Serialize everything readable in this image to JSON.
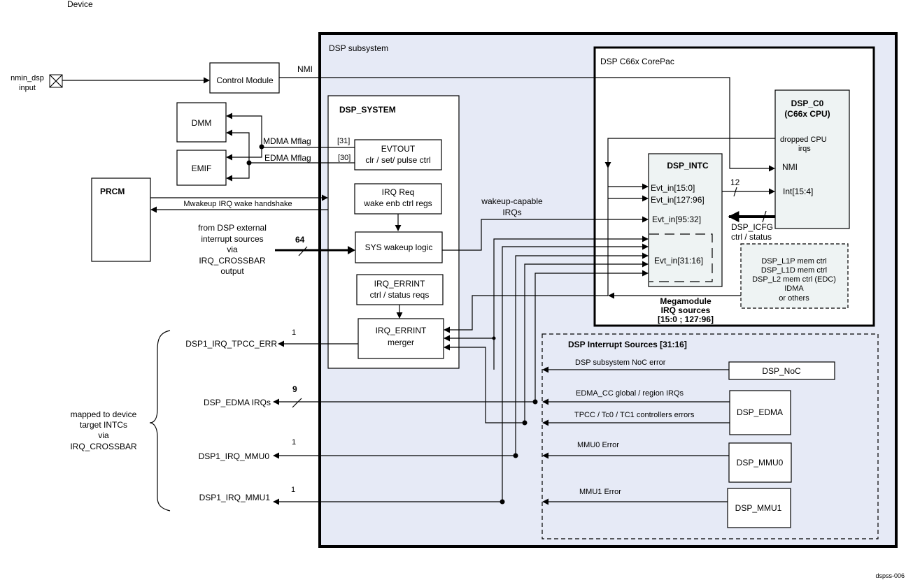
{
  "figure_id": "dspss-006",
  "colors": {
    "subsystem_fill": "#e6eaf6",
    "corepac_fill": "#ffffff",
    "module_fill": "#eef3f3",
    "line": "#000000"
  },
  "device_label": "Device",
  "external": {
    "nmin_dsp": "nmin_dsp",
    "nmin_input": "input",
    "control_module": "Control Module",
    "nmi": "NMI",
    "dmm": "DMM",
    "emif": "EMIF",
    "mdma_mflag": "MDMA Mflag",
    "edma_mflag": "EDMA Mflag",
    "prcm": "PRCM",
    "mwakeup": "Mwakeup IRQ wake handshake",
    "ext_sources": [
      "from DSP external",
      "interrupt sources",
      "via",
      "IRQ_CROSSBAR",
      "output"
    ],
    "bus64": "64"
  },
  "outputs": {
    "tpcc_err": "DSP1_IRQ_TPCC_ERR",
    "tpcc_err_width": "1",
    "edma_irqs": "DSP_EDMA IRQs",
    "edma_width": "9",
    "mmu0": "DSP1_IRQ_MMU0",
    "mmu0_width": "1",
    "mmu1": "DSP1_IRQ_MMU1",
    "mmu1_width": "1",
    "mapped_note": [
      "mapped to device",
      "target INTCs",
      "via",
      "IRQ_CROSSBAR"
    ]
  },
  "subsystem": {
    "title": "DSP  subsystem",
    "dsp_system": {
      "title": "DSP_SYSTEM",
      "bit31": "[31]",
      "bit30": "[30]",
      "evtout": [
        "EVTOUT",
        "clr / set/ pulse ctrl"
      ],
      "irq_req": [
        "IRQ  Req",
        "wake enb ctrl regs"
      ],
      "wakeup_logic": "SYS wakeup logic",
      "errint_regs": [
        "IRQ_ERRINT",
        "ctrl / status reqs"
      ],
      "errint_merger": [
        "IRQ_ERRINT",
        "merger"
      ]
    },
    "wakeup_capable": [
      "wakeup-capable",
      "IRQs"
    ],
    "corepac": {
      "title": "DSP  C66x CorePac",
      "cpu": [
        "DSP_C0",
        "(C66x CPU)"
      ],
      "dropped": [
        "dropped CPU",
        "irqs"
      ],
      "nmi": "NMI",
      "int": "Int[15:4]",
      "intc_title": "DSP_INTC",
      "evt_15_0": "Evt_in[15:0]",
      "evt_127_96": "Evt_in[127:96]",
      "evt_95_32": "Evt_in[95:32]",
      "evt_31_16": "Evt_in[31:16]",
      "bus12": "12",
      "icfg": [
        "DSP_ICFG",
        "ctrl  / status"
      ],
      "mem": [
        "DSP_L1P  mem ctrl",
        "DSP_L1D mem ctrl",
        "DSP_L2 mem ctrl (EDC)",
        "IDMA",
        "or others"
      ],
      "megamodule": [
        "Megamodule",
        "IRQ sources",
        "[15:0 ;  127:96]"
      ]
    },
    "sources": {
      "title": "DSP Interrupt Sources [31:16]",
      "noc_err": "DSP subsystem  NoC error",
      "noc": "DSP_NoC",
      "edma_cc": "EDMA_CC global / region  IRQs",
      "tpcc_errs": "TPCC / Tc0 / TC1  controllers  errors",
      "edma": "DSP_EDMA",
      "mmu0_err": "MMU0 Error",
      "mmu0": "DSP_MMU0",
      "mmu1_err": "MMU1 Error",
      "mmu1": "DSP_MMU1"
    }
  }
}
